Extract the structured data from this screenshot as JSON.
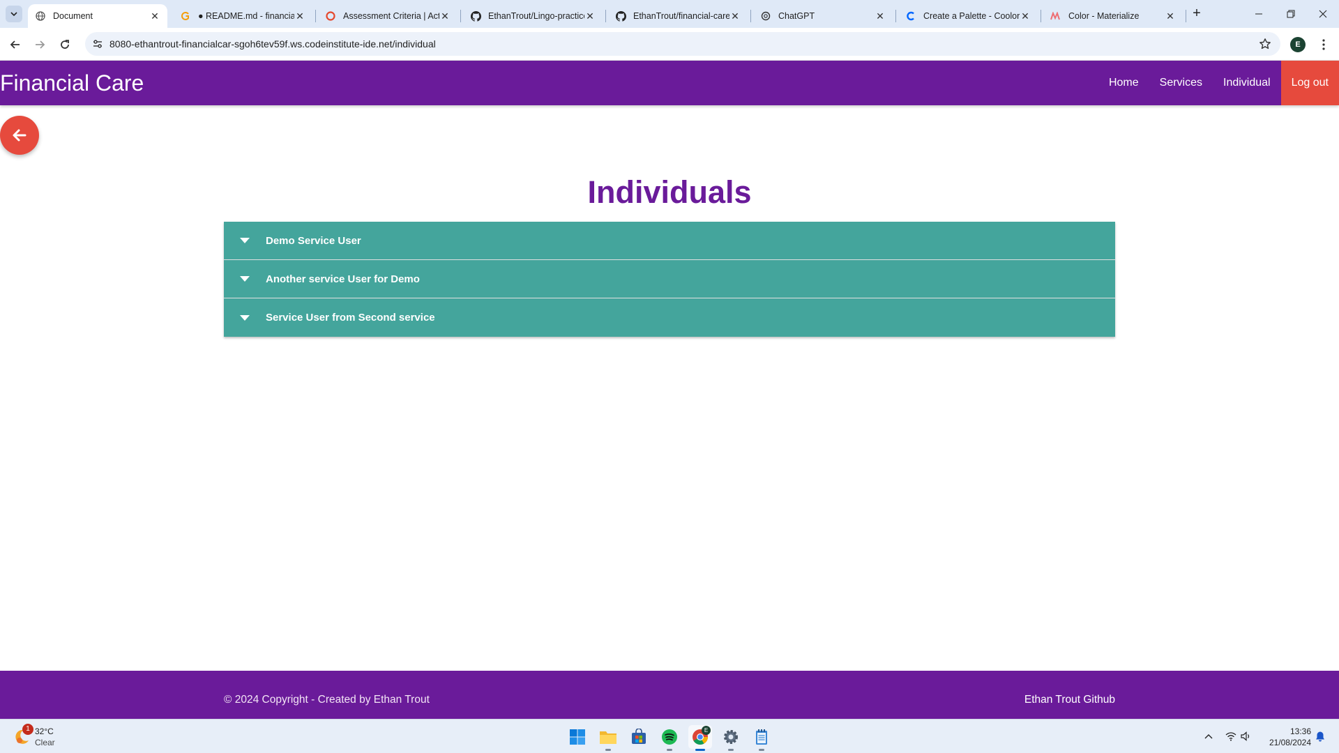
{
  "browser": {
    "tabs": [
      {
        "title": "Document",
        "icon": "globe-icon",
        "active": true
      },
      {
        "title": "● README.md - financial-",
        "icon": "gitpod-icon",
        "active": false
      },
      {
        "title": "Assessment Criteria | Acti",
        "icon": "ci-icon",
        "active": false
      },
      {
        "title": "EthanTrout/Lingo-practice",
        "icon": "github-icon",
        "active": false
      },
      {
        "title": "EthanTrout/financial-care:",
        "icon": "github-icon",
        "active": false
      },
      {
        "title": "ChatGPT",
        "icon": "chatgpt-icon",
        "active": false
      },
      {
        "title": "Create a Palette - Coolors",
        "icon": "coolors-icon",
        "active": false
      },
      {
        "title": "Color - Materialize",
        "icon": "materialize-icon",
        "active": false
      }
    ],
    "url": "8080-ethantrout-financialcar-sgoh6tev59f.ws.codeinstitute-ide.net/individual",
    "profile_initial": "E"
  },
  "site": {
    "brand": "Financial Care",
    "nav": {
      "home": "Home",
      "services": "Services",
      "individual": "Individual",
      "logout": "Log out"
    },
    "heading": "Individuals",
    "individuals": [
      {
        "name": "Demo Service User"
      },
      {
        "name": "Another service User for Demo"
      },
      {
        "name": "Service User from Second service"
      }
    ],
    "footer": {
      "copyright": "© 2024 Copyright - Created by Ethan Trout",
      "github_link": "Ethan Trout Github"
    },
    "colors": {
      "primary": "#6a1b9a",
      "accent": "#e64a3d",
      "collapsible": "#44a59c"
    }
  },
  "taskbar": {
    "weather": {
      "temp": "32°C",
      "condition": "Clear",
      "badge": "1"
    },
    "chrome_badge": "E",
    "clock": {
      "time": "13:36",
      "date": "21/08/2024"
    }
  }
}
